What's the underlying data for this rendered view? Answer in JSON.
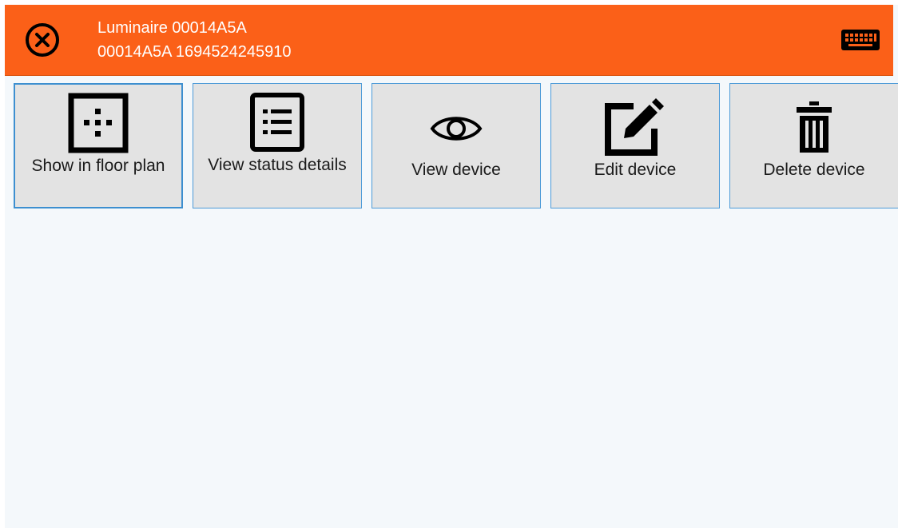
{
  "header": {
    "title": "Luminaire 00014A5A",
    "subtitle": "00014A5A 1694524245910",
    "close_icon": "close-circle-icon",
    "keyboard_icon": "keyboard-icon",
    "background_color": "#fb6018"
  },
  "actions": [
    {
      "label": "Show in floor plan",
      "icon": "floor-plan-icon",
      "selected": true
    },
    {
      "label": "View status details",
      "icon": "list-icon",
      "selected": false
    },
    {
      "label": "View device",
      "icon": "eye-icon",
      "selected": false
    },
    {
      "label": "Edit device",
      "icon": "edit-icon",
      "selected": false
    },
    {
      "label": "Delete device",
      "icon": "trash-icon",
      "selected": false
    }
  ]
}
